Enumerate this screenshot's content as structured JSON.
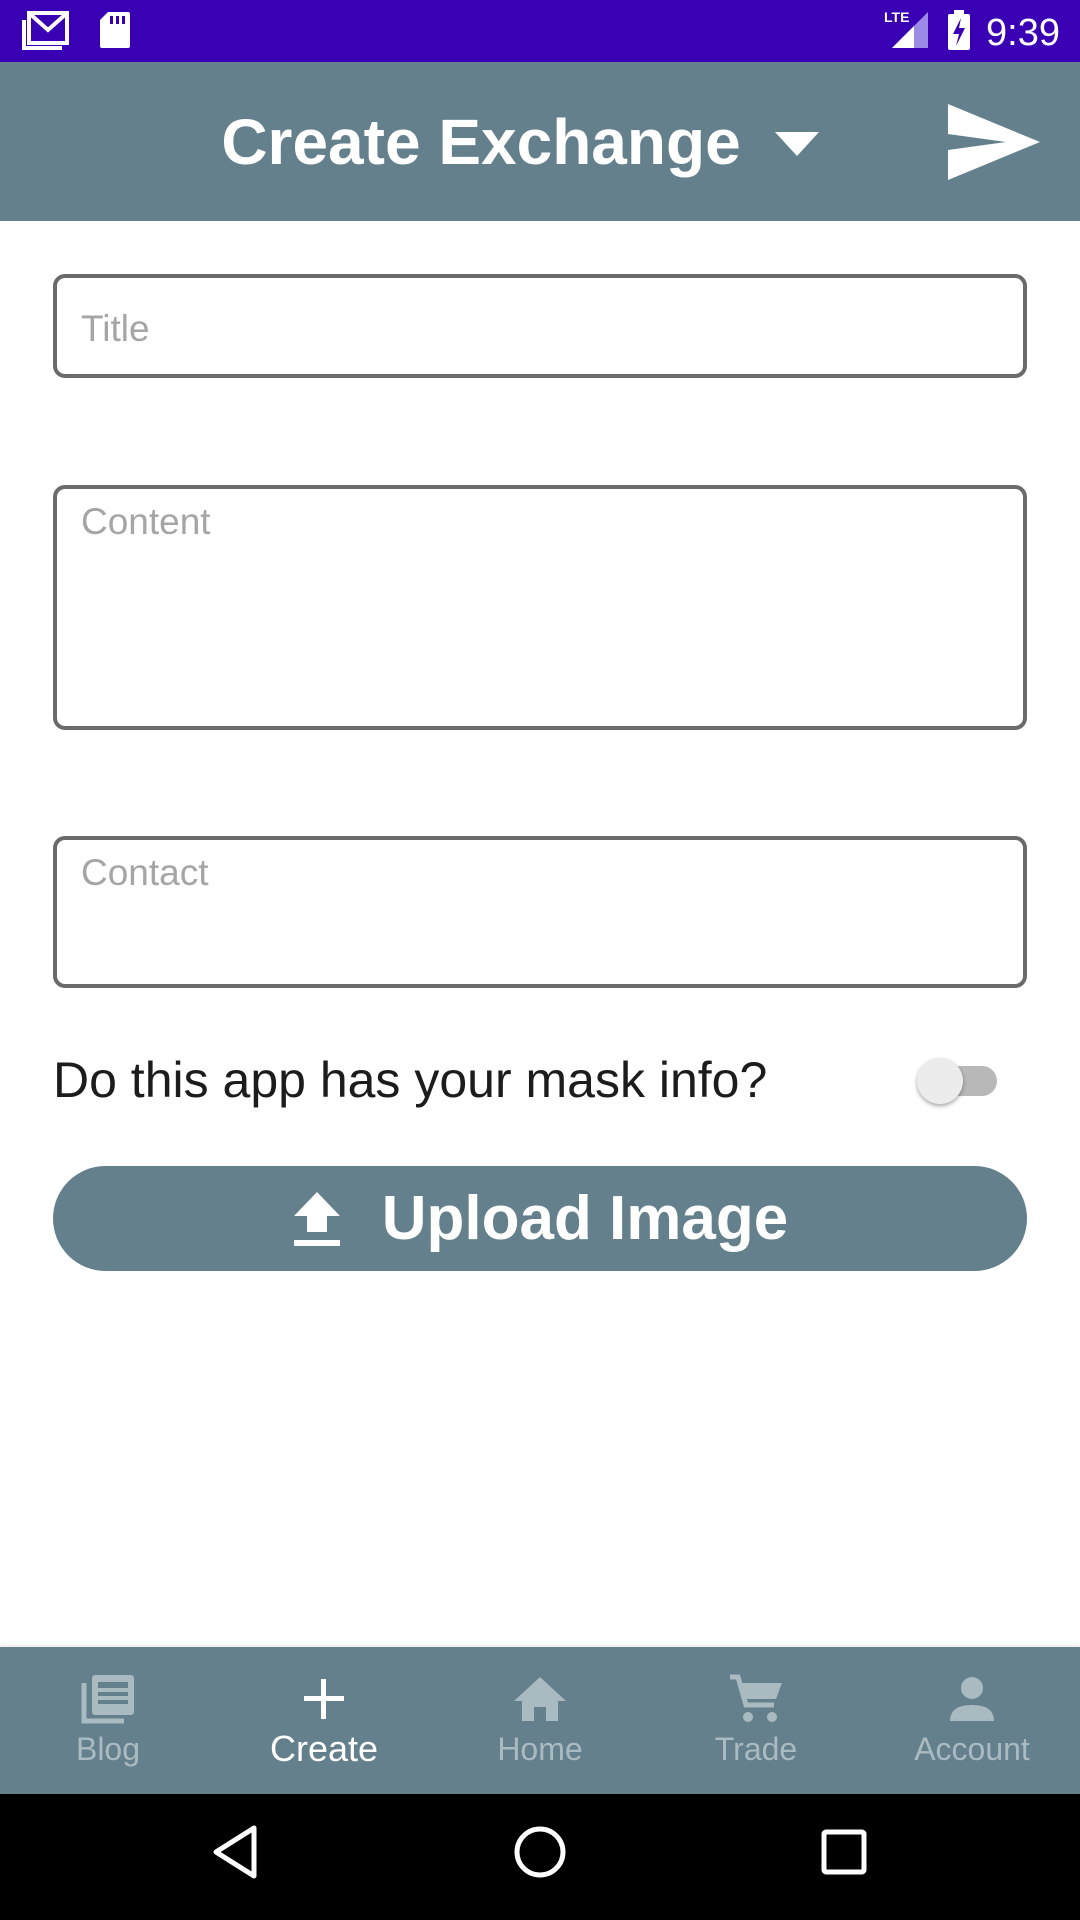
{
  "status_bar": {
    "time": "9:39",
    "left_icons": [
      "gmail-icon",
      "sd-card-icon"
    ],
    "right_icons": [
      "lte-signal-icon",
      "battery-charging-icon"
    ],
    "network_label": "LTE",
    "background": "#3a00b3"
  },
  "app_bar": {
    "title": "Create Exchange",
    "dropdown_icon": "caret-down-icon",
    "action_icon": "send-icon",
    "background": "#64808c"
  },
  "form": {
    "title_placeholder": "Title",
    "title_value": "",
    "content_placeholder": "Content",
    "content_value": "",
    "contact_placeholder": "Contact",
    "contact_value": "",
    "mask_question": "Do this app has your mask info?",
    "mask_toggle_on": false,
    "upload_label": "Upload Image",
    "upload_icon": "upload-icon"
  },
  "bottom_nav": {
    "active": "Create",
    "items": [
      {
        "label": "Blog",
        "icon": "blog-icon"
      },
      {
        "label": "Create",
        "icon": "plus-icon"
      },
      {
        "label": "Home",
        "icon": "home-icon"
      },
      {
        "label": "Trade",
        "icon": "cart-icon"
      },
      {
        "label": "Account",
        "icon": "account-icon"
      }
    ]
  },
  "system_nav": {
    "icons": [
      "back-icon",
      "home-circle-icon",
      "recents-icon"
    ]
  }
}
